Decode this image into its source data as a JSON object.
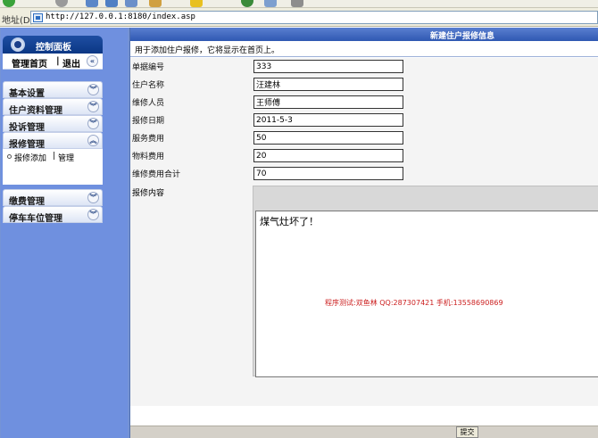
{
  "browser": {
    "address_label": "地址(D)",
    "url": "http://127.0.0.1:8180/index.asp"
  },
  "sidebar": {
    "header_title": "控制面板",
    "home_link": "管理首页",
    "separator": "|",
    "logout_link": "退出",
    "collapse_icon": "«",
    "menus": [
      {
        "label": "基本设置",
        "expanded": false
      },
      {
        "label": "住户资料管理",
        "expanded": false
      },
      {
        "label": "投诉管理",
        "expanded": false
      },
      {
        "label": "报修管理",
        "expanded": true
      },
      {
        "label": "缴费管理",
        "expanded": false
      },
      {
        "label": "停车车位管理",
        "expanded": false
      }
    ],
    "submenu": {
      "add_link": "报修添加",
      "separator": "|",
      "manage_link": "管理"
    }
  },
  "main": {
    "title": "新建住户报修信息",
    "description": "用于添加住户报修，它将显示在首页上。",
    "fields": [
      {
        "label": "单据编号",
        "value": "333"
      },
      {
        "label": "住户名称",
        "value": "汪建林"
      },
      {
        "label": "维修人员",
        "value": "王师傅"
      },
      {
        "label": "报修日期",
        "value": "2011-5-3"
      },
      {
        "label": "服务费用",
        "value": "50"
      },
      {
        "label": "物料费用",
        "value": "20"
      },
      {
        "label": "维修费用合计",
        "value": "70"
      }
    ],
    "content_label": "报修内容",
    "content_text": "煤气灶坏了！",
    "credit": "程序测试:双鱼林 QQ:287307421 手机:13558690869",
    "submit_label": "提交"
  },
  "colors": {
    "sidebar_bg": "#6f90df",
    "title_bar": "#2f58b2",
    "credit_text": "#cc2020"
  }
}
